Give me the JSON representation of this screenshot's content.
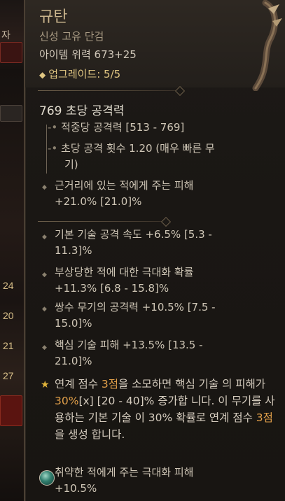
{
  "background": {
    "labels": [
      "자",
      "24",
      "20",
      "21",
      "27"
    ]
  },
  "item": {
    "name": "규탄",
    "type": "신성 고유 단검",
    "power": "아이템 위력 673+25",
    "upgrade": "업그레이드: 5/5"
  },
  "dps": "769 초당 공격력",
  "weapon_stats": [
    {
      "label": "적중당 공격력 [513 - 769]"
    },
    {
      "label": "초당 공격 횟수 1.20 (매우 빠른 무",
      "cont": "기)"
    }
  ],
  "implicit": {
    "line1": "근거리에 있는 적에게 주는 피해",
    "line2": "+21.0% [21.0]%"
  },
  "affixes": [
    {
      "line1": "기본 기술 공격 속도 +6.5%  [5.3 -",
      "line2": "11.3]%"
    },
    {
      "line1": "부상당한 적에 대한 극대화 확률",
      "line2": "+11.3% [6.8 - 15.8]%"
    },
    {
      "line1": "쌍수 무기의 공격력 +10.5% [7.5 -",
      "line2": "15.0]%"
    },
    {
      "line1": "핵심 기술 피해 +13.5% [13.5 -",
      "line2": "21.0]%"
    }
  ],
  "legendary": {
    "p1": "연계 점수 ",
    "p2": "3점",
    "p3": "을 소모하면 핵심 기술",
    "p4": "의 피해가 ",
    "p5": "30%",
    "p6": "[x] [20 - 40]% 증가합",
    "p7": "니다. 이 무기를 사용하는 기본 기술",
    "p8": "이 30% 확률로 연계 점수 ",
    "p9": "3점",
    "p10": "을 생성",
    "p11": "합니다."
  },
  "socket": {
    "line1": "취약한 적에게 주는 극대화 피해",
    "line2": "+10.5%"
  },
  "colors": {
    "title": "#c9b48c",
    "upgrade": "#e0c682",
    "legendary_value": "#e2a04a"
  }
}
